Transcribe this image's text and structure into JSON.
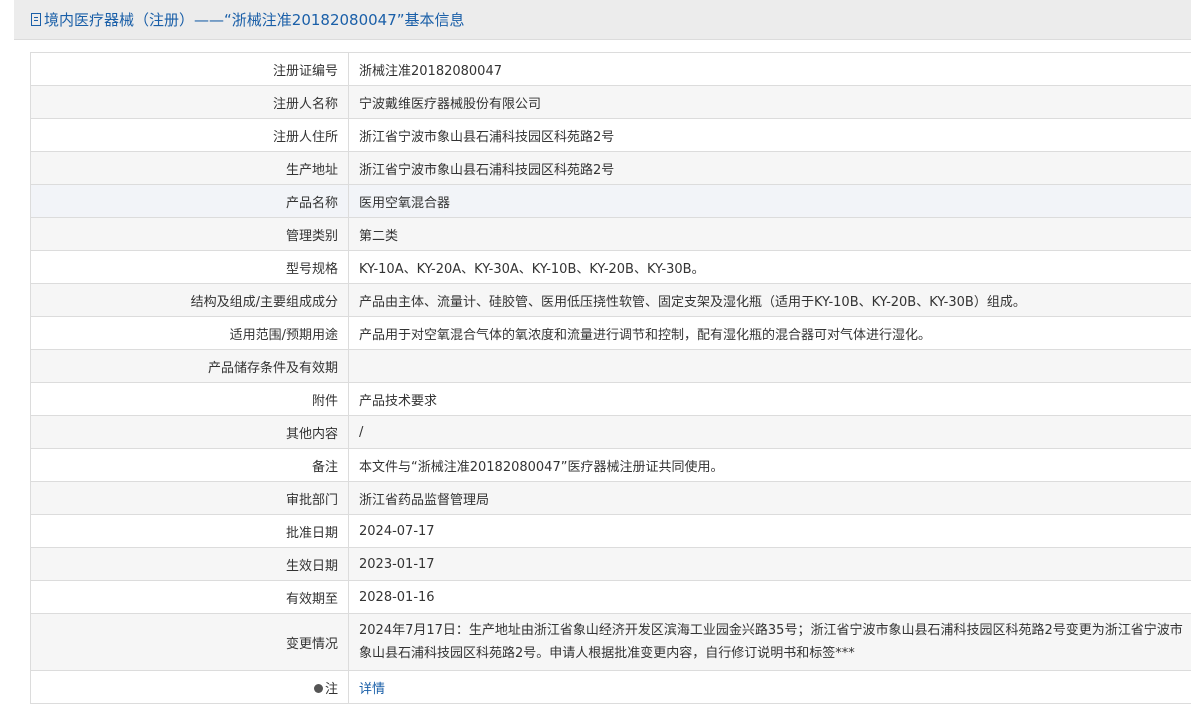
{
  "header": {
    "icon": "document-icon",
    "title": "境内医疗器械（注册）——“浙械注准20182080047”基本信息"
  },
  "rows": [
    {
      "label": "注册证编号",
      "value": "浙械注准20182080047"
    },
    {
      "label": "注册人名称",
      "value": "宁波戴维医疗器械股份有限公司"
    },
    {
      "label": "注册人住所",
      "value": "浙江省宁波市象山县石浦科技园区科苑路2号"
    },
    {
      "label": "生产地址",
      "value": "浙江省宁波市象山县石浦科技园区科苑路2号"
    },
    {
      "label": "产品名称",
      "value": "医用空氧混合器"
    },
    {
      "label": "管理类别",
      "value": "第二类"
    },
    {
      "label": "型号规格",
      "value": "KY-10A、KY-20A、KY-30A、KY-10B、KY-20B、KY-30B。"
    },
    {
      "label": "结构及组成/主要组成成分",
      "value": "产品由主体、流量计、硅胶管、医用低压挠性软管、固定支架及湿化瓶（适用于KY-10B、KY-20B、KY-30B）组成。"
    },
    {
      "label": "适用范围/预期用途",
      "value": "产品用于对空氧混合气体的氧浓度和流量进行调节和控制，配有湿化瓶的混合器可对气体进行湿化。"
    },
    {
      "label": "产品储存条件及有效期",
      "value": ""
    },
    {
      "label": "附件",
      "value": "产品技术要求"
    },
    {
      "label": "其他内容",
      "value": "/"
    },
    {
      "label": "备注",
      "value": "本文件与“浙械注准20182080047”医疗器械注册证共同使用。"
    },
    {
      "label": "审批部门",
      "value": "浙江省药品监督管理局"
    },
    {
      "label": "批准日期",
      "value": "2024-07-17"
    },
    {
      "label": "生效日期",
      "value": "2023-01-17"
    },
    {
      "label": "有效期至",
      "value": "2028-01-16"
    },
    {
      "label": "变更情况",
      "value": "2024年7月17日：生产地址由浙江省象山经济开发区滨海工业园金兴路35号；浙江省宁波市象山县石浦科技园区科苑路2号变更为浙江省宁波市象山县石浦科技园区科苑路2号。申请人根据批准变更内容，自行修订说明书和标签***"
    },
    {
      "label": "注",
      "value": "详情"
    }
  ]
}
